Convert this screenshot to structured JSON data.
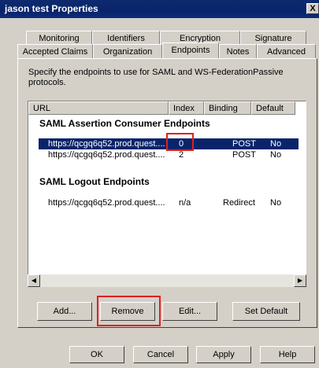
{
  "window": {
    "title": "jason test Properties",
    "close_label": "X"
  },
  "tabs_row1": [
    "Monitoring",
    "Identifiers",
    "Encryption",
    "Signature"
  ],
  "tabs_row2": [
    "Accepted Claims",
    "Organization",
    "Endpoints",
    "Notes",
    "Advanced"
  ],
  "active_tab": "Endpoints",
  "description": "Specify the endpoints to use for SAML and WS-FederationPassive protocols.",
  "columns": [
    "URL",
    "Index",
    "Binding",
    "Default"
  ],
  "groups": [
    {
      "title": "SAML Assertion Consumer Endpoints",
      "rows": [
        {
          "url": "https://qcgq6q52.prod.quest....",
          "index": "0",
          "binding": "POST",
          "default": "No",
          "selected": true
        },
        {
          "url": "https://qcgq6q52.prod.quest....",
          "index": "2",
          "binding": "POST",
          "default": "No",
          "selected": false
        }
      ]
    },
    {
      "title": "SAML Logout Endpoints",
      "rows": [
        {
          "url": "https://qcgq6q52.prod.quest....",
          "index": "n/a",
          "binding": "Redirect",
          "default": "No",
          "selected": false
        }
      ]
    }
  ],
  "panel_buttons": {
    "add": "Add...",
    "remove": "Remove",
    "edit": "Edit...",
    "set_default": "Set Default"
  },
  "dialog_buttons": {
    "ok": "OK",
    "cancel": "Cancel",
    "apply": "Apply",
    "help": "Help"
  },
  "colors": {
    "titlebar": "#0a246a",
    "selection": "#0a246a",
    "highlight": "#e02020",
    "face": "#d4d0c8"
  }
}
